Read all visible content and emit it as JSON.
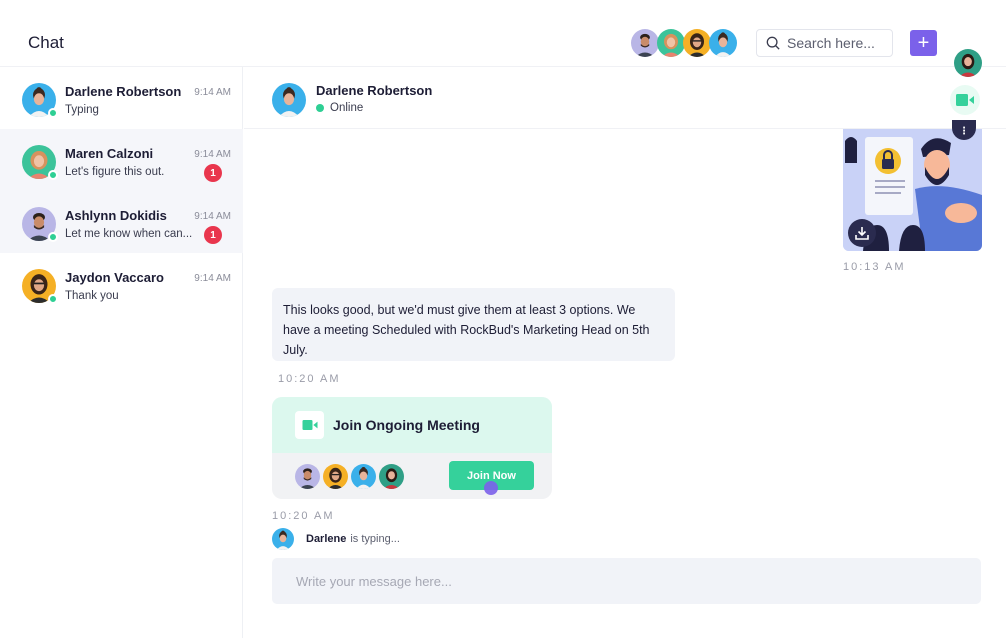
{
  "header": {
    "title": "Chat",
    "search_placeholder": "Search here...",
    "add_button": "+",
    "participant_avatars": [
      "man-purple-bg",
      "woman-green-bg",
      "woman-yellow-bg",
      "woman-blue-bg"
    ]
  },
  "contacts": [
    {
      "name": "Darlene Robertson",
      "preview": "Typing",
      "time": "9:14 AM",
      "unread": null,
      "online": true
    },
    {
      "name": "Maren Calzoni",
      "preview": "Let's figure this out.",
      "time": "9:14 AM",
      "unread": "1",
      "online": true
    },
    {
      "name": "Ashlynn Dokidis",
      "preview": "Let me know when can...",
      "time": "9:14 AM",
      "unread": "1",
      "online": true
    },
    {
      "name": "Jaydon Vaccaro",
      "preview": "Thank you",
      "time": "9:14 AM",
      "unread": null,
      "online": true
    }
  ],
  "chat": {
    "contact_name": "Darlene Robertson",
    "status": "Online",
    "messages": [
      {
        "type": "image",
        "time": "10:13 AM",
        "alt": "security document illustration"
      },
      {
        "type": "text",
        "text": "This looks good, but we'd must give them at least 3 options. We have a meeting Scheduled with RockBud's Marketing Head on 5th July.",
        "time": "10:20 AM"
      },
      {
        "type": "meeting",
        "title": "Join Ongoing Meeting",
        "button": "Join Now",
        "time": "10:20 AM"
      }
    ],
    "typing_name": "Darlene",
    "typing_text": "is typing...",
    "composer_placeholder": "Write your message here..."
  },
  "colors": {
    "accent": "#7b61ea",
    "online": "#2ecf94",
    "badge": "#e9364d",
    "join": "#35d19b"
  }
}
